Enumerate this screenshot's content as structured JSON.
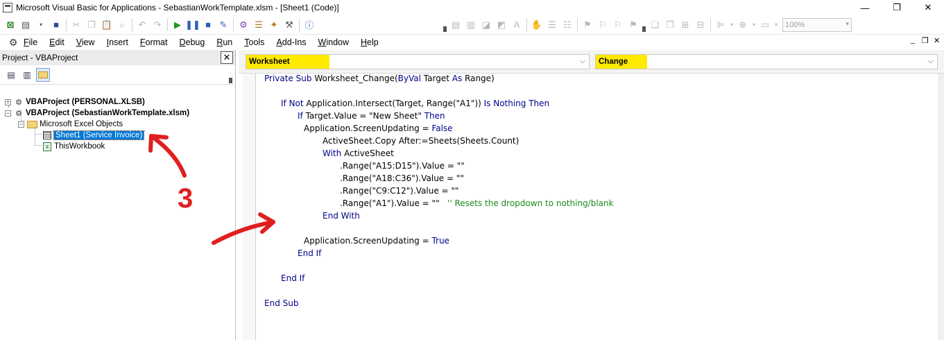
{
  "window": {
    "title": "Microsoft Visual Basic for Applications - SebastianWorkTemplate.xlsm - [Sheet1 (Code)]",
    "minimize_glyph": "—",
    "restore_glyph": "❐",
    "close_glyph": "✕"
  },
  "toolbar": {
    "zoom_value": "100%"
  },
  "menu": {
    "items": [
      {
        "label": "File",
        "underline": "F",
        "rest": "ile"
      },
      {
        "label": "Edit",
        "underline": "E",
        "rest": "dit"
      },
      {
        "label": "View",
        "underline": "V",
        "rest": "iew"
      },
      {
        "label": "Insert",
        "underline": "I",
        "rest": "nsert"
      },
      {
        "label": "Format",
        "underline": "F",
        "rest": "ormat"
      },
      {
        "label": "Debug",
        "underline": "D",
        "rest": "ebug"
      },
      {
        "label": "Run",
        "underline": "R",
        "rest": "un"
      },
      {
        "label": "Tools",
        "underline": "T",
        "rest": "ools"
      },
      {
        "label": "Add-Ins",
        "underline": "A",
        "rest": "dd-Ins"
      },
      {
        "label": "Window",
        "underline": "W",
        "rest": "indow"
      },
      {
        "label": "Help",
        "underline": "H",
        "rest": "elp"
      }
    ],
    "mdi_min": "_",
    "mdi_restore": "❐",
    "mdi_close": "✕"
  },
  "project_panel": {
    "title": "Project - VBAProject",
    "close_glyph": "✕",
    "tree": {
      "personal": "VBAProject (PERSONAL.XLSB)",
      "workbook": "VBAProject (SebastianWorkTemplate.xlsm)",
      "folder": "Microsoft Excel Objects",
      "sheet1": "Sheet1 (Service Invoice)",
      "thisworkbook": "ThisWorkbook"
    }
  },
  "code_window": {
    "object_combo": "Worksheet",
    "procedure_combo": "Change",
    "lines": [
      "Private Sub Worksheet_Change(ByVal Target As Range)",
      "If Not Application.Intersect(Target, Range(\"A1\")) Is Nothing Then",
      "If Target.Value = \"New Sheet\" Then",
      "Application.ScreenUpdating = False",
      "ActiveSheet.Copy After:=Sheets(Sheets.Count)",
      "With ActiveSheet",
      ".Range(\"A15:D15\").Value = \"\"",
      ".Range(\"A18:C36\").Value = \"\"",
      ".Range(\"C9:C12\").Value = \"\"",
      ".Range(\"A1\").Value = \"\"",
      "'' Resets the dropdown to nothing/blank",
      "End With",
      "Application.ScreenUpdating = True",
      "End If",
      "End If",
      "End Sub"
    ]
  },
  "annotations": {
    "number_label": "3",
    "color": "#e02020"
  },
  "colors": {
    "highlight": "#ffeb00",
    "selection": "#0078d7",
    "keyword": "#00008b",
    "comment": "#1a8a1a"
  }
}
